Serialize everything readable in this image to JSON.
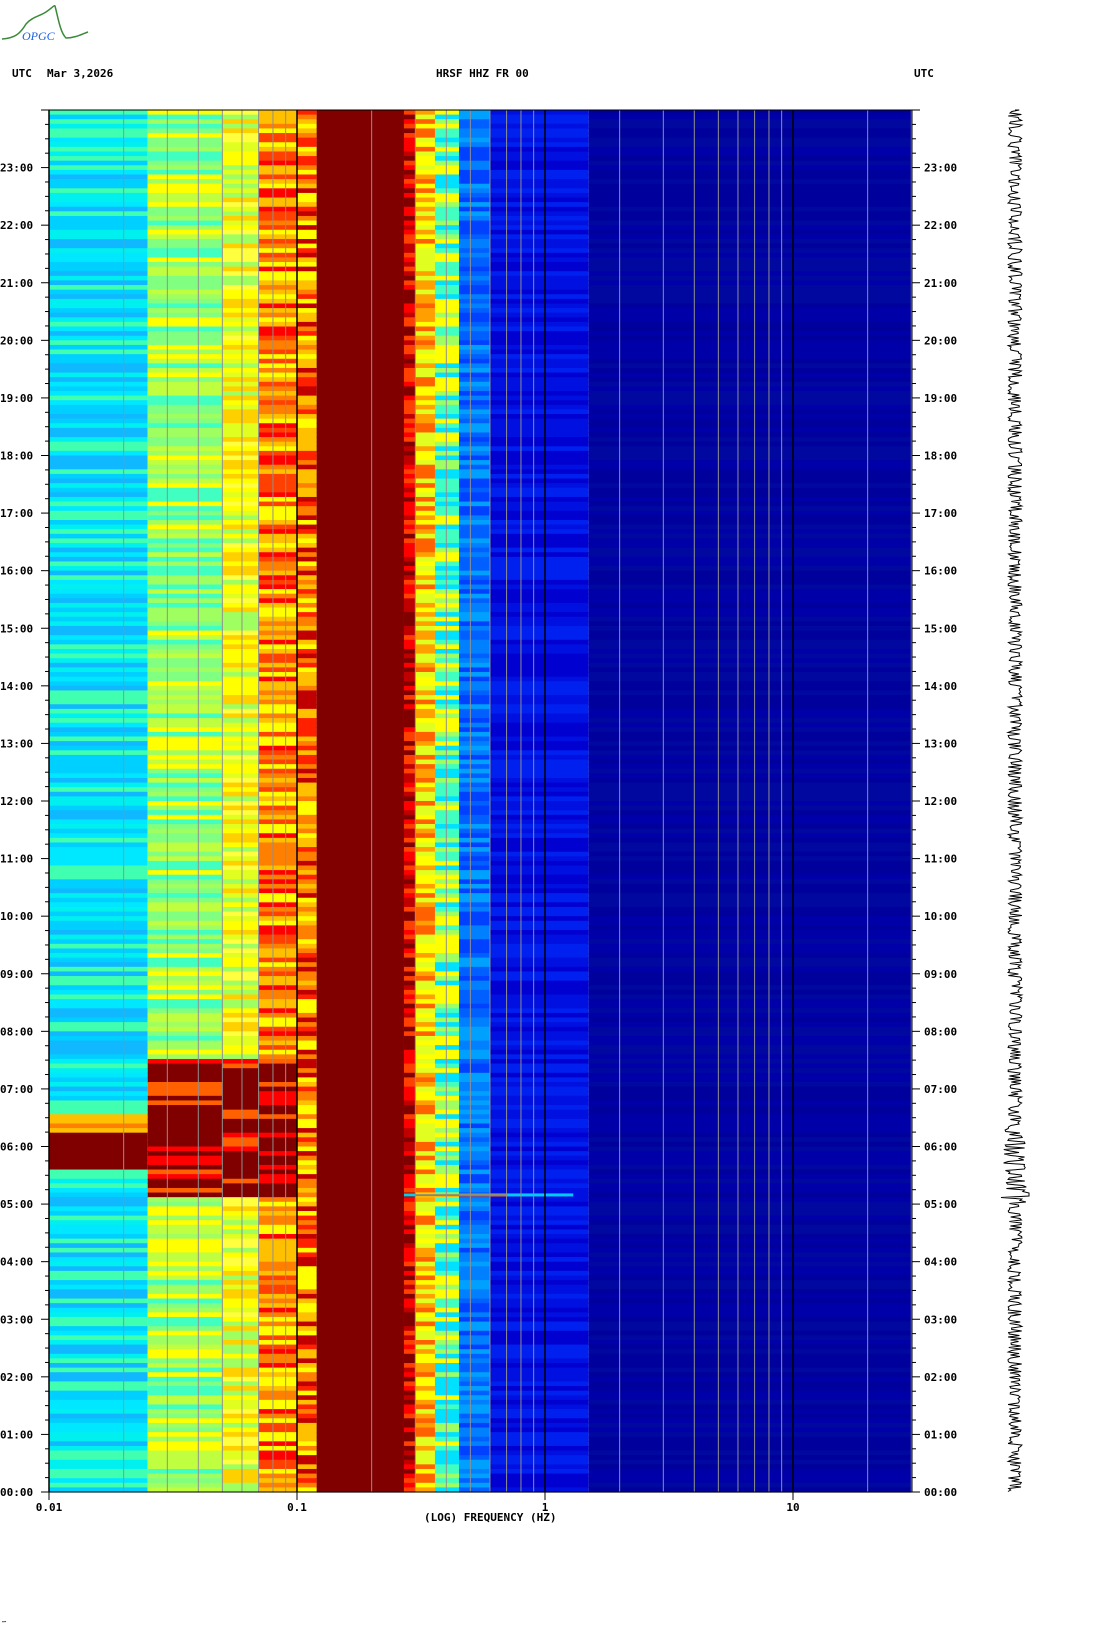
{
  "logo": {
    "text": "OPGC"
  },
  "header": {
    "left_tz": "UTC",
    "date": "Mar 3,2026",
    "station": "HRSF HHZ FR 00",
    "right_tz": "UTC"
  },
  "footer": {
    "mark": "‴"
  },
  "chart_data": {
    "type": "heatmap",
    "title": "HRSF HHZ FR 00",
    "xlabel": "(LOG) FREQUENCY (HZ)",
    "ylabel": "UTC",
    "xscale": "log",
    "xlim": [
      0.01,
      30
    ],
    "ylim_hours": [
      0,
      24
    ],
    "x_ticks": [
      {
        "v": 0.01,
        "label": "0.01"
      },
      {
        "v": 0.1,
        "label": "0.1"
      },
      {
        "v": 1,
        "label": "1"
      },
      {
        "v": 10,
        "label": "10"
      }
    ],
    "y_ticks": [
      "00:00",
      "01:00",
      "02:00",
      "03:00",
      "04:00",
      "05:00",
      "06:00",
      "07:00",
      "08:00",
      "09:00",
      "10:00",
      "11:00",
      "12:00",
      "13:00",
      "14:00",
      "15:00",
      "16:00",
      "17:00",
      "18:00",
      "19:00",
      "20:00",
      "21:00",
      "22:00",
      "23:00"
    ],
    "bands": [
      {
        "f": [
          0.01,
          0.025
        ],
        "colors": [
          "#00e8ff",
          "#00d0ff",
          "#10b8ff",
          "#40ffb0",
          "#00f0f0"
        ]
      },
      {
        "f": [
          0.025,
          0.05
        ],
        "colors": [
          "#80ff80",
          "#c0ff40",
          "#40ffc0",
          "#ffff00",
          "#a0ff60"
        ]
      },
      {
        "f": [
          0.05,
          0.07
        ],
        "colors": [
          "#ffff00",
          "#e0ff20",
          "#ffd000",
          "#a0ff60",
          "#ffff40"
        ]
      },
      {
        "f": [
          0.07,
          0.1
        ],
        "colors": [
          "#ff8000",
          "#ff4000",
          "#ffc000",
          "#ff0000",
          "#ffff00"
        ]
      },
      {
        "f": [
          0.1,
          0.12
        ],
        "colors": [
          "#ffff00",
          "#ff8000",
          "#ff2000",
          "#ffc000",
          "#c00000"
        ]
      },
      {
        "f": [
          0.12,
          0.27
        ],
        "colors": [
          "#800000"
        ]
      },
      {
        "f": [
          0.27,
          0.3
        ],
        "colors": [
          "#ff0000",
          "#c00000",
          "#ff4000",
          "#800000"
        ]
      },
      {
        "f": [
          0.3,
          0.36
        ],
        "colors": [
          "#ffa000",
          "#ffff00",
          "#ff6000",
          "#e0ff20"
        ]
      },
      {
        "f": [
          0.36,
          0.45
        ],
        "colors": [
          "#a0ff60",
          "#40ffc0",
          "#00e0ff",
          "#ffff00"
        ]
      },
      {
        "f": [
          0.45,
          0.6
        ],
        "colors": [
          "#0080ff",
          "#0040ff",
          "#0060ff",
          "#00a0ff"
        ]
      },
      {
        "f": [
          0.6,
          1.5
        ],
        "colors": [
          "#0010e0",
          "#0000d0",
          "#0020f0"
        ]
      },
      {
        "f": [
          1.5,
          30
        ],
        "colors": [
          "#00009c",
          "#0000a8",
          "#0008a0"
        ]
      }
    ],
    "event": {
      "time_hours": 5.15,
      "f_range": [
        0.27,
        1.3
      ]
    },
    "high_energy_period_hours": [
      5.1,
      7.5
    ],
    "colors": {
      "background": "#ffffff",
      "grid_minor": "#909090",
      "grid_major": "#000000"
    }
  }
}
